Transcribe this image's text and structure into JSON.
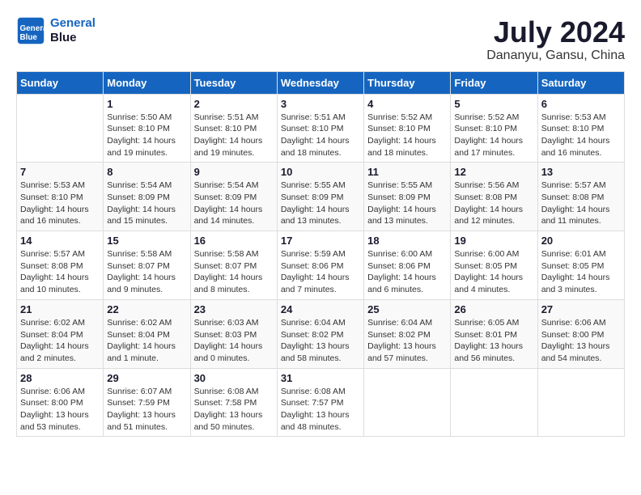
{
  "logo": {
    "line1": "General",
    "line2": "Blue"
  },
  "title": "July 2024",
  "subtitle": "Dananyu, Gansu, China",
  "weekdays": [
    "Sunday",
    "Monday",
    "Tuesday",
    "Wednesday",
    "Thursday",
    "Friday",
    "Saturday"
  ],
  "weeks": [
    [
      {
        "day": "",
        "info": ""
      },
      {
        "day": "1",
        "info": "Sunrise: 5:50 AM\nSunset: 8:10 PM\nDaylight: 14 hours\nand 19 minutes."
      },
      {
        "day": "2",
        "info": "Sunrise: 5:51 AM\nSunset: 8:10 PM\nDaylight: 14 hours\nand 19 minutes."
      },
      {
        "day": "3",
        "info": "Sunrise: 5:51 AM\nSunset: 8:10 PM\nDaylight: 14 hours\nand 18 minutes."
      },
      {
        "day": "4",
        "info": "Sunrise: 5:52 AM\nSunset: 8:10 PM\nDaylight: 14 hours\nand 18 minutes."
      },
      {
        "day": "5",
        "info": "Sunrise: 5:52 AM\nSunset: 8:10 PM\nDaylight: 14 hours\nand 17 minutes."
      },
      {
        "day": "6",
        "info": "Sunrise: 5:53 AM\nSunset: 8:10 PM\nDaylight: 14 hours\nand 16 minutes."
      }
    ],
    [
      {
        "day": "7",
        "info": "Sunrise: 5:53 AM\nSunset: 8:10 PM\nDaylight: 14 hours\nand 16 minutes."
      },
      {
        "day": "8",
        "info": "Sunrise: 5:54 AM\nSunset: 8:09 PM\nDaylight: 14 hours\nand 15 minutes."
      },
      {
        "day": "9",
        "info": "Sunrise: 5:54 AM\nSunset: 8:09 PM\nDaylight: 14 hours\nand 14 minutes."
      },
      {
        "day": "10",
        "info": "Sunrise: 5:55 AM\nSunset: 8:09 PM\nDaylight: 14 hours\nand 13 minutes."
      },
      {
        "day": "11",
        "info": "Sunrise: 5:55 AM\nSunset: 8:09 PM\nDaylight: 14 hours\nand 13 minutes."
      },
      {
        "day": "12",
        "info": "Sunrise: 5:56 AM\nSunset: 8:08 PM\nDaylight: 14 hours\nand 12 minutes."
      },
      {
        "day": "13",
        "info": "Sunrise: 5:57 AM\nSunset: 8:08 PM\nDaylight: 14 hours\nand 11 minutes."
      }
    ],
    [
      {
        "day": "14",
        "info": "Sunrise: 5:57 AM\nSunset: 8:08 PM\nDaylight: 14 hours\nand 10 minutes."
      },
      {
        "day": "15",
        "info": "Sunrise: 5:58 AM\nSunset: 8:07 PM\nDaylight: 14 hours\nand 9 minutes."
      },
      {
        "day": "16",
        "info": "Sunrise: 5:58 AM\nSunset: 8:07 PM\nDaylight: 14 hours\nand 8 minutes."
      },
      {
        "day": "17",
        "info": "Sunrise: 5:59 AM\nSunset: 8:06 PM\nDaylight: 14 hours\nand 7 minutes."
      },
      {
        "day": "18",
        "info": "Sunrise: 6:00 AM\nSunset: 8:06 PM\nDaylight: 14 hours\nand 6 minutes."
      },
      {
        "day": "19",
        "info": "Sunrise: 6:00 AM\nSunset: 8:05 PM\nDaylight: 14 hours\nand 4 minutes."
      },
      {
        "day": "20",
        "info": "Sunrise: 6:01 AM\nSunset: 8:05 PM\nDaylight: 14 hours\nand 3 minutes."
      }
    ],
    [
      {
        "day": "21",
        "info": "Sunrise: 6:02 AM\nSunset: 8:04 PM\nDaylight: 14 hours\nand 2 minutes."
      },
      {
        "day": "22",
        "info": "Sunrise: 6:02 AM\nSunset: 8:04 PM\nDaylight: 14 hours\nand 1 minute."
      },
      {
        "day": "23",
        "info": "Sunrise: 6:03 AM\nSunset: 8:03 PM\nDaylight: 14 hours\nand 0 minutes."
      },
      {
        "day": "24",
        "info": "Sunrise: 6:04 AM\nSunset: 8:02 PM\nDaylight: 13 hours\nand 58 minutes."
      },
      {
        "day": "25",
        "info": "Sunrise: 6:04 AM\nSunset: 8:02 PM\nDaylight: 13 hours\nand 57 minutes."
      },
      {
        "day": "26",
        "info": "Sunrise: 6:05 AM\nSunset: 8:01 PM\nDaylight: 13 hours\nand 56 minutes."
      },
      {
        "day": "27",
        "info": "Sunrise: 6:06 AM\nSunset: 8:00 PM\nDaylight: 13 hours\nand 54 minutes."
      }
    ],
    [
      {
        "day": "28",
        "info": "Sunrise: 6:06 AM\nSunset: 8:00 PM\nDaylight: 13 hours\nand 53 minutes."
      },
      {
        "day": "29",
        "info": "Sunrise: 6:07 AM\nSunset: 7:59 PM\nDaylight: 13 hours\nand 51 minutes."
      },
      {
        "day": "30",
        "info": "Sunrise: 6:08 AM\nSunset: 7:58 PM\nDaylight: 13 hours\nand 50 minutes."
      },
      {
        "day": "31",
        "info": "Sunrise: 6:08 AM\nSunset: 7:57 PM\nDaylight: 13 hours\nand 48 minutes."
      },
      {
        "day": "",
        "info": ""
      },
      {
        "day": "",
        "info": ""
      },
      {
        "day": "",
        "info": ""
      }
    ]
  ]
}
